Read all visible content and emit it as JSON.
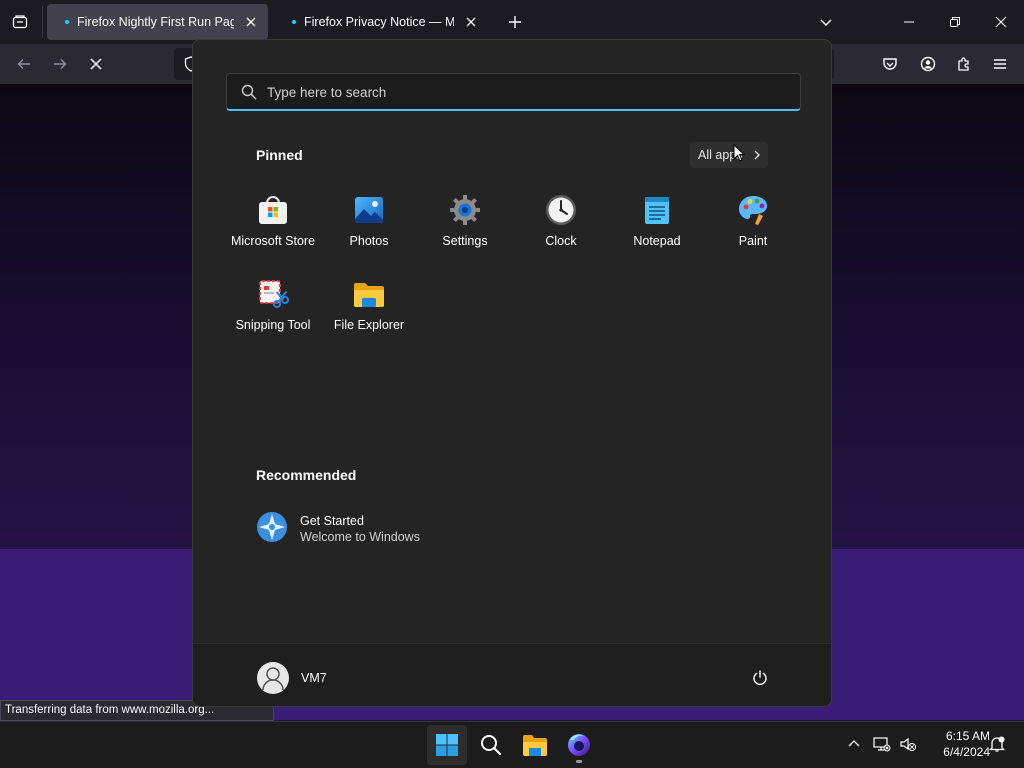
{
  "browser": {
    "tabs": [
      {
        "title": "Firefox Nightly First Run Page",
        "active": true
      },
      {
        "title": "Firefox Privacy Notice — Mozilla",
        "active": false
      }
    ],
    "status_text": "Transferring data from www.mozilla.org..."
  },
  "start_menu": {
    "search_placeholder": "Type here to search",
    "pinned_title": "Pinned",
    "all_apps_label": "All apps",
    "pinned_apps": [
      {
        "name": "Microsoft Store",
        "icon": "microsoft-store-icon"
      },
      {
        "name": "Photos",
        "icon": "photos-icon"
      },
      {
        "name": "Settings",
        "icon": "settings-gear-icon"
      },
      {
        "name": "Clock",
        "icon": "clock-icon"
      },
      {
        "name": "Notepad",
        "icon": "notepad-icon"
      },
      {
        "name": "Paint",
        "icon": "paint-palette-icon"
      },
      {
        "name": "Snipping Tool",
        "icon": "snipping-tool-icon"
      },
      {
        "name": "File Explorer",
        "icon": "folder-icon"
      }
    ],
    "recommended_title": "Recommended",
    "recommended": [
      {
        "title": "Get Started",
        "subtitle": "Welcome to Windows"
      }
    ],
    "user_name": "VM7"
  },
  "taskbar": {
    "time": "6:15 AM",
    "date": "6/4/2024"
  },
  "colors": {
    "accent": "#4cc2ff",
    "firefox_tab_dot": "#00ddff",
    "page_purple": "#3a1d77"
  }
}
